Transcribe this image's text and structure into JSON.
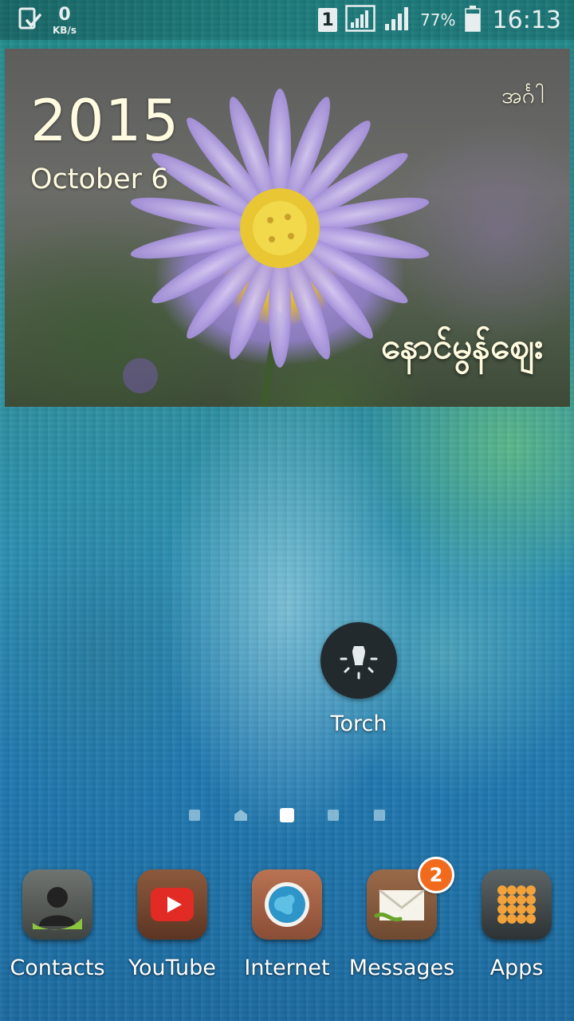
{
  "status_bar": {
    "net_speed_value": "0",
    "net_speed_unit": "KB/s",
    "sim_slot": "1",
    "battery_percent": "77%",
    "battery_level": 0.77,
    "time": "16:13",
    "icons": [
      "download-complete-icon",
      "sim-signal-icon",
      "signal-icon",
      "battery-icon"
    ]
  },
  "widget": {
    "year": "2015",
    "date": "October 6",
    "weekday": "အင်္ဂါ",
    "location": "နောင်မွန်ဈေး"
  },
  "home": {
    "torch": {
      "label": "Torch",
      "icon": "lightbulb-icon"
    }
  },
  "page_indicator": {
    "pages": 5,
    "active_index": 2,
    "home_index": 1
  },
  "dock": {
    "items": [
      {
        "label": "Contacts",
        "icon": "contacts-icon"
      },
      {
        "label": "YouTube",
        "icon": "youtube-icon"
      },
      {
        "label": "Internet",
        "icon": "globe-icon"
      },
      {
        "label": "Messages",
        "icon": "envelope-icon",
        "badge": "2"
      },
      {
        "label": "Apps",
        "icon": "apps-grid-icon"
      }
    ]
  },
  "colors": {
    "badge": "#f26a1b",
    "widget_text": "#fffbe0"
  }
}
